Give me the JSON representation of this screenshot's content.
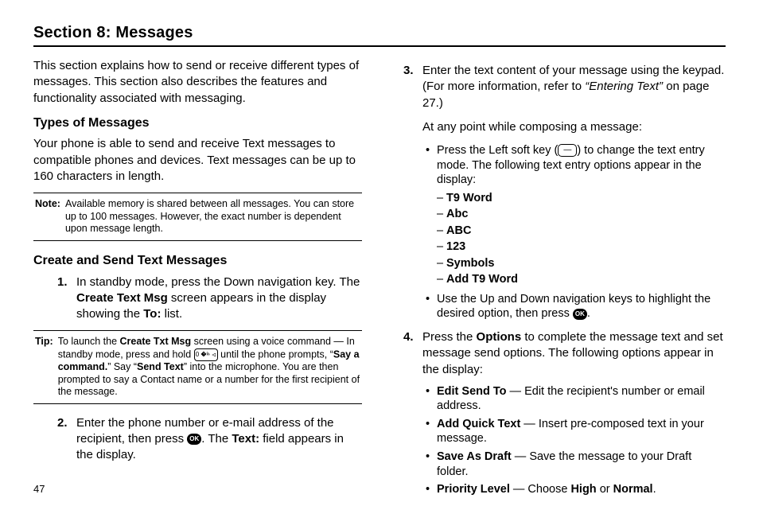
{
  "title": "Section 8: Messages",
  "pageNumber": "47",
  "left": {
    "intro": "This section explains how to send or receive different types of messages. This section also describes the features and functionality associated with messaging.",
    "h_types": "Types of Messages",
    "types_para": "Your phone is able to send and receive Text messages to compatible phones and devices. Text messages can be up to 160 characters in length.",
    "note": {
      "label": "Note:",
      "text": "Available memory is shared between all messages. You can store up to 100 messages. However, the exact number is dependent upon message length."
    },
    "h_create": "Create and Send Text Messages",
    "step1_a": "In standby mode, press the Down navigation key. The ",
    "step1_b": "Create Text Msg",
    "step1_c": " screen appears in the display showing the ",
    "step1_d": "To:",
    "step1_e": " list.",
    "tip": {
      "label": "Tip:",
      "t1": "To launch the ",
      "t2": "Create Txt Msg",
      "t3": " screen using a voice command — In standby mode, press and hold ",
      "t4": " until the phone prompts, “",
      "t5": "Say a command.",
      "t6": "” Say “",
      "t7": "Send Text",
      "t8": "” into the microphone. You are then prompted to say a Contact name or a number for the first recipient of the message."
    },
    "step2_a": "Enter the phone number or e-mail address of the recipient, then press ",
    "step2_b": ". The ",
    "step2_c": "Text:",
    "step2_d": " field appears in the display."
  },
  "right": {
    "step3_a": "Enter the text content of your message using the keypad. (For more information, refer to ",
    "step3_b": "“Entering Text”",
    "step3_c": " on page 27.)",
    "compose_intro": "At any point while composing a message:",
    "bullet1_a": "Press the Left soft key (",
    "bullet1_b": ") to change the text entry mode. The following text entry options appear in the display:",
    "modes": {
      "t9": "T9 Word",
      "abc1": "Abc",
      "abc2": "ABC",
      "num": "123",
      "sym": "Symbols",
      "addt9": "Add T9 Word"
    },
    "bullet2_a": "Use the Up and Down navigation keys to highlight the desired option, then press ",
    "bullet2_b": ".",
    "step4_a": "Press the ",
    "step4_b": "Options",
    "step4_c": " to complete the message text and set message send options. The following options appear in the display:",
    "opts": {
      "o1a": "Edit Send To",
      "o1b": " — Edit the recipient's number or email address.",
      "o2a": "Add Quick Text",
      "o2b": " — Insert pre-composed text in your message.",
      "o3a": "Save As Draft",
      "o3b": " — Save the message to your Draft folder.",
      "o4a": "Priority Level",
      "o4b": " — Choose ",
      "o4c": "High",
      "o4d": " or ",
      "o4e": "Normal",
      "o4f": "."
    }
  },
  "numbers": {
    "n1": "1.",
    "n2": "2.",
    "n3": "3.",
    "n4": "4."
  },
  "icons": {
    "ok": "OK",
    "key": "0 �ⰳ ⏿",
    "softkey": "—"
  }
}
